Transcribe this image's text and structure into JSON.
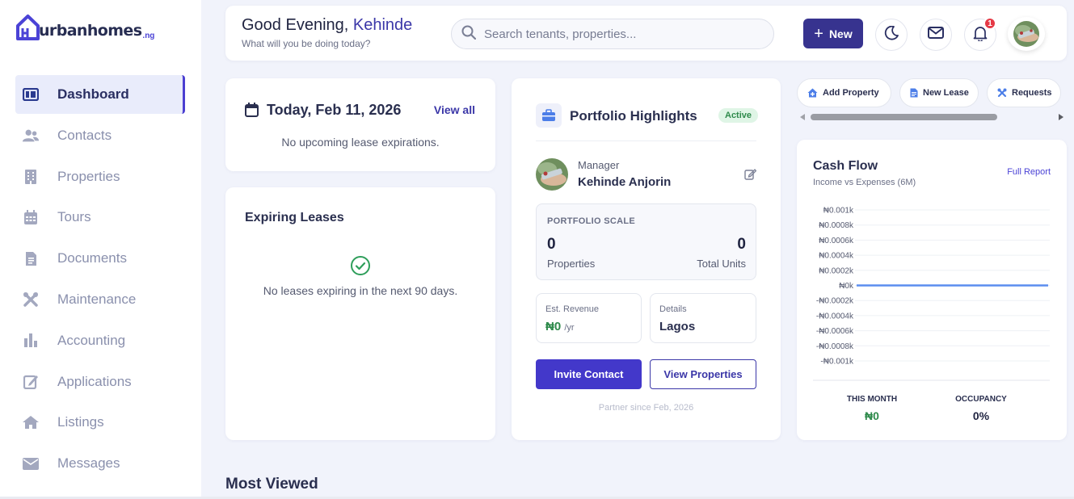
{
  "brand": {
    "name": "urbanhomes",
    "suffix": ".ng"
  },
  "sidebar": {
    "items": [
      {
        "label": "Dashboard",
        "icon": "dashboard-icon",
        "active": true
      },
      {
        "label": "Contacts",
        "icon": "contacts-icon"
      },
      {
        "label": "Properties",
        "icon": "building-icon"
      },
      {
        "label": "Tours",
        "icon": "calendar-icon"
      },
      {
        "label": "Documents",
        "icon": "document-icon"
      },
      {
        "label": "Maintenance",
        "icon": "tools-icon"
      },
      {
        "label": "Accounting",
        "icon": "chart-bar-icon"
      },
      {
        "label": "Applications",
        "icon": "edit-icon"
      },
      {
        "label": "Listings",
        "icon": "home-icon"
      },
      {
        "label": "Messages",
        "icon": "envelope-icon"
      }
    ]
  },
  "header": {
    "greeting": "Good Evening,",
    "user_name": "Kehinde",
    "subtitle": "What will you be doing today?",
    "search_placeholder": "Search tenants, properties...",
    "new_label": "New",
    "notification_count": "1"
  },
  "today": {
    "title": "Today, Feb 11, 2026",
    "view_all": "View all",
    "empty": "No upcoming lease expirations."
  },
  "expiring": {
    "title": "Expiring Leases",
    "message": "No leases expiring in the next 90 days."
  },
  "portfolio": {
    "title": "Portfolio Highlights",
    "status": "Active",
    "manager_label": "Manager",
    "manager_name": "Kehinde Anjorin",
    "scale_label": "PORTFOLIO SCALE",
    "properties_value": "0",
    "properties_label": "Properties",
    "units_value": "0",
    "units_label": "Total Units",
    "revenue_label": "Est. Revenue",
    "revenue_value": "₦0",
    "revenue_unit": "/yr",
    "details_label": "Details",
    "details_value": "Lagos",
    "invite_label": "Invite Contact",
    "view_label": "View Properties",
    "partner_since": "Partner since Feb, 2026"
  },
  "quick_actions": {
    "add_property": "Add Property",
    "new_lease": "New Lease",
    "requests": "Requests"
  },
  "cash_flow": {
    "title": "Cash Flow",
    "subtitle": "Income vs Expenses (6M)",
    "full_report": "Full Report",
    "this_month_label": "THIS MONTH",
    "this_month_value": "₦0",
    "occupancy_label": "OCCUPANCY",
    "occupancy_value": "0%",
    "colors": {
      "line": "#5b8def",
      "grid": "#eef0f5",
      "money": "#2e8a4b"
    }
  },
  "chart_data": {
    "type": "line",
    "title": "Cash Flow",
    "subtitle": "Income vs Expenses (6M)",
    "ylim": [
      -0.001,
      0.001
    ],
    "y_ticks": [
      "₦0.001k",
      "₦0.0008k",
      "₦0.0006k",
      "₦0.0004k",
      "₦0.0002k",
      "₦0k",
      "-₦0.0002k",
      "-₦0.0004k",
      "-₦0.0006k",
      "-₦0.0008k",
      "-₦0.001k"
    ],
    "series": [
      {
        "values": [
          0,
          0,
          0,
          0,
          0,
          0
        ]
      }
    ],
    "grid": true
  },
  "most_viewed": {
    "title": "Most Viewed"
  }
}
